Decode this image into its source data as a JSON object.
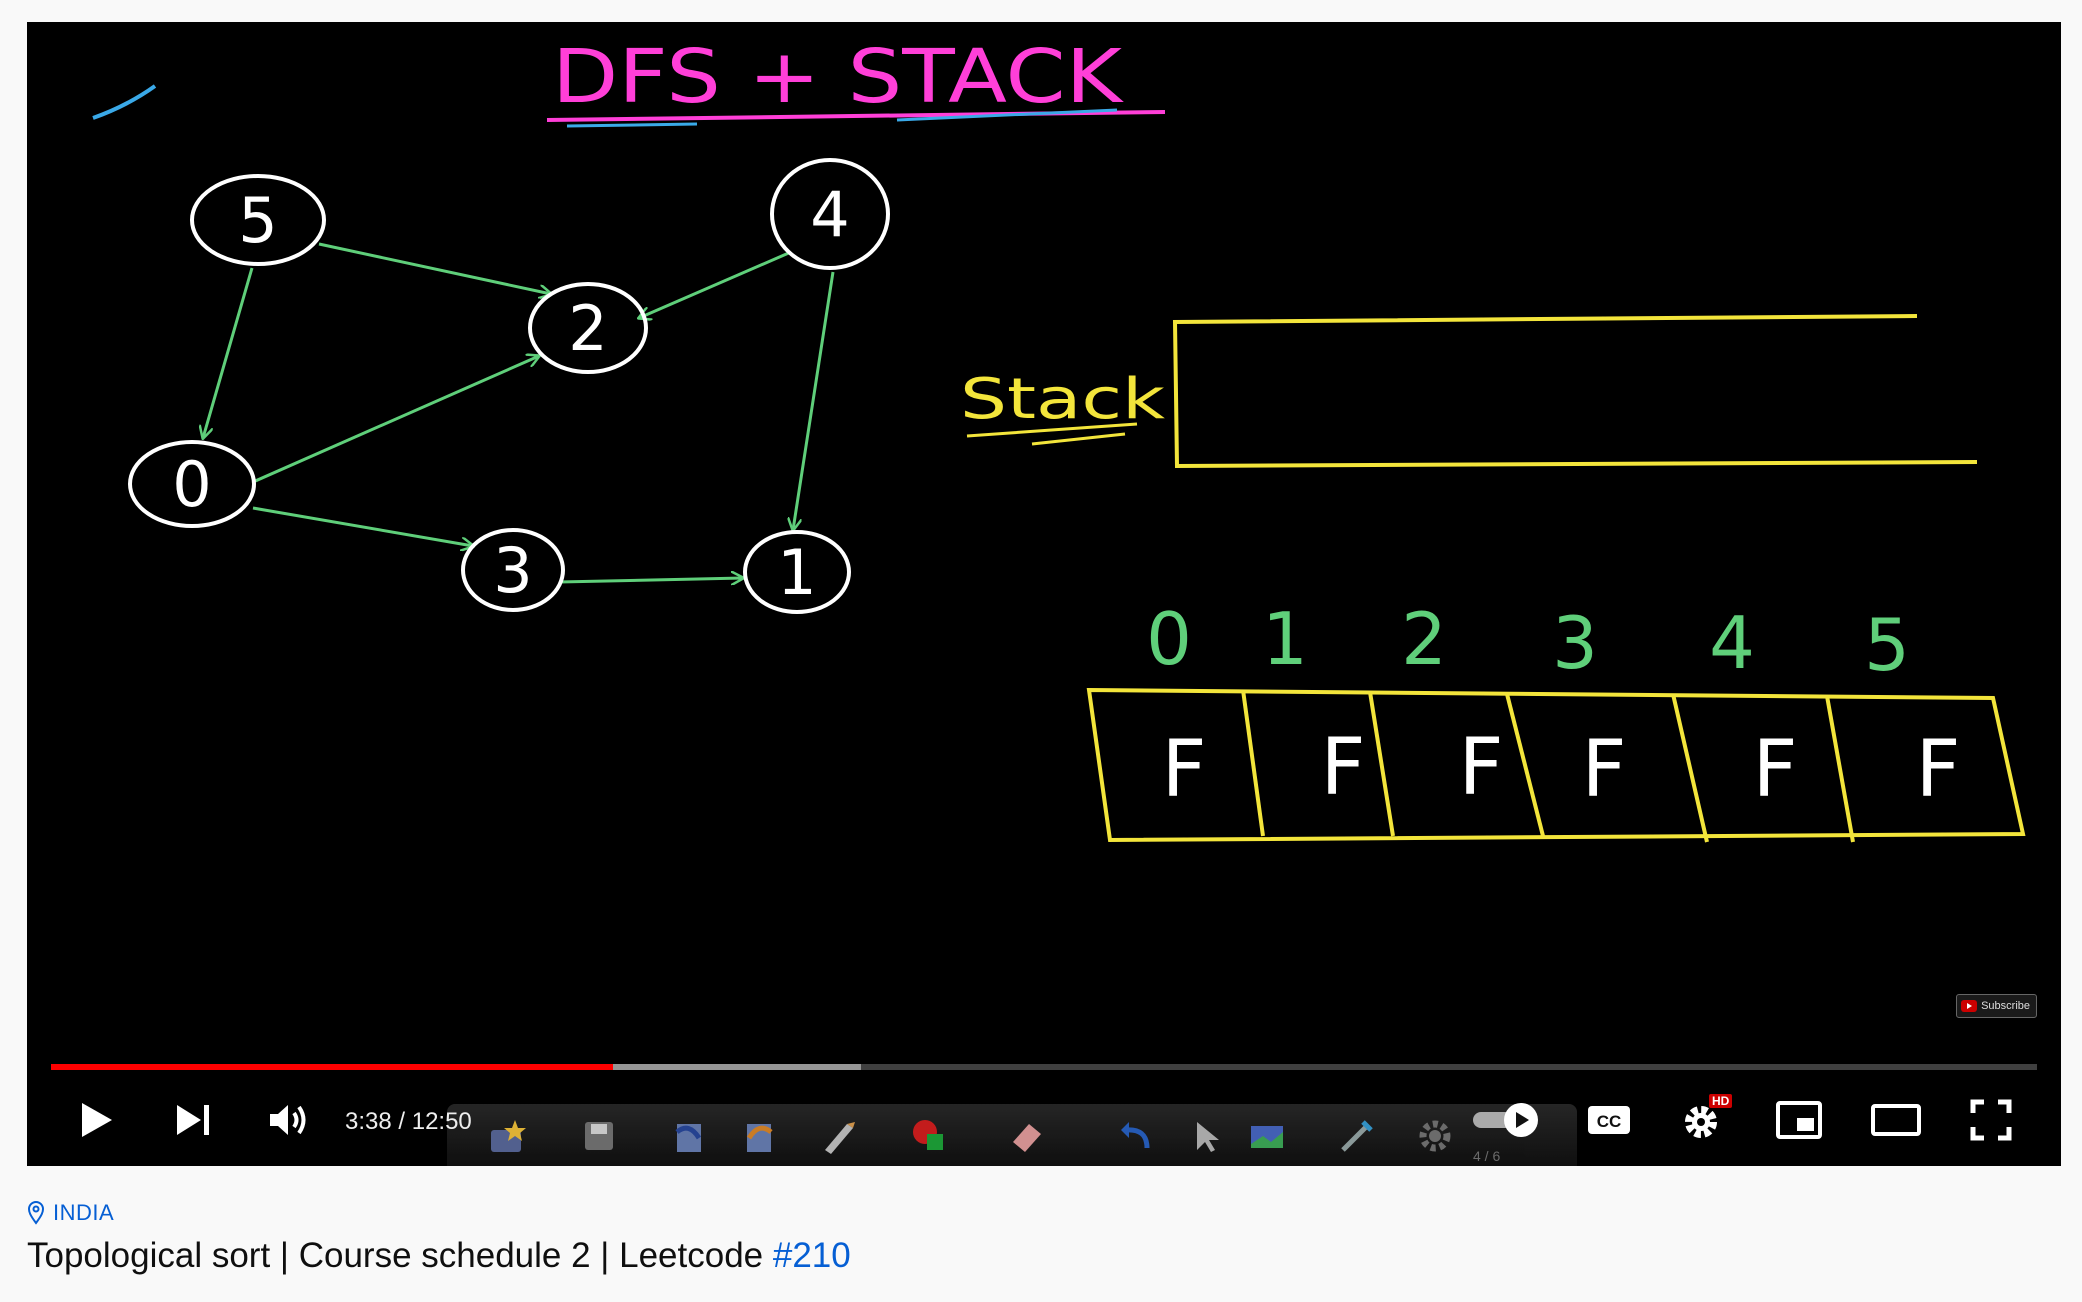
{
  "board": {
    "heading": "DFS + STACK",
    "stack_label": "Stack",
    "graph": {
      "nodes": [
        "5",
        "4",
        "2",
        "0",
        "3",
        "1"
      ],
      "edges": [
        [
          "5",
          "2"
        ],
        [
          "5",
          "0"
        ],
        [
          "4",
          "2"
        ],
        [
          "4",
          "1"
        ],
        [
          "0",
          "2"
        ],
        [
          "0",
          "3"
        ],
        [
          "3",
          "1"
        ]
      ]
    },
    "visited": {
      "indices": [
        "0",
        "1",
        "2",
        "3",
        "4",
        "5"
      ],
      "values": [
        "F",
        "F",
        "F",
        "F",
        "F",
        "F"
      ]
    }
  },
  "player": {
    "subscribe_label": "Subscribe",
    "current_time": "3:38",
    "duration": "12:50",
    "time_display": "3:38 / 12:50",
    "progress_fraction": 0.283,
    "buffered_fraction": 0.408,
    "quality_badge": "HD",
    "page_indicator": "4 / 6",
    "colors": {
      "progress": "#ff0000",
      "badge": "#cc0000"
    }
  },
  "video": {
    "location": "INDIA",
    "title_text": "Topological sort | Course schedule 2 | Leetcode ",
    "hashtag": "#210",
    "link_color": "#065fd4"
  }
}
